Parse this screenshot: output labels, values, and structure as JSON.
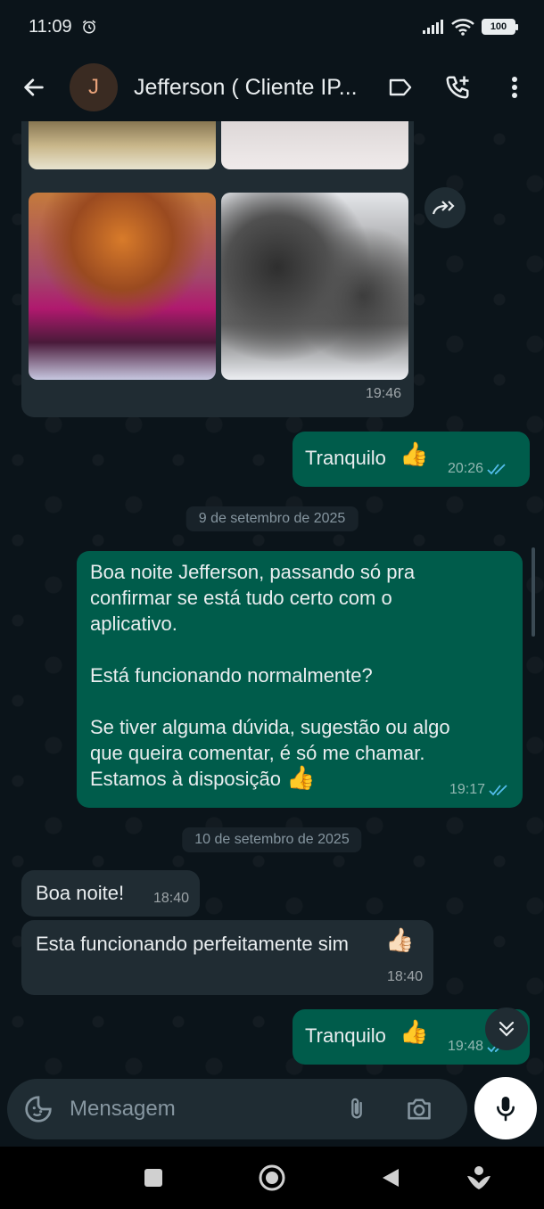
{
  "status_bar": {
    "time": "11:09",
    "battery": "100",
    "icons": [
      "alarm-icon",
      "signal-icon",
      "wifi-icon",
      "battery-icon"
    ]
  },
  "header": {
    "avatar_initial": "J",
    "contact_name": "Jefferson ( Cliente IP...",
    "icons": [
      "back-arrow-icon",
      "label-icon",
      "add-call-icon",
      "more-vert-icon"
    ]
  },
  "colors": {
    "background": "#0b141a",
    "incoming_bubble": "#202c33",
    "outgoing_bubble": "#005c4b",
    "read_ticks": "#53bdeb"
  },
  "messages": [
    {
      "id": "album",
      "direction": "in",
      "type": "photo-album",
      "time": "19:46"
    },
    {
      "id": "m1",
      "direction": "out",
      "text": "Tranquilo",
      "emoji": "👍",
      "time": "20:26",
      "read": true
    },
    {
      "id": "d1",
      "type": "date",
      "text": "9 de setembro de 2025"
    },
    {
      "id": "m2",
      "direction": "out",
      "lines": [
        "Boa noite Jefferson, passando só pra",
        "confirmar se está tudo certo com o",
        "aplicativo.",
        "",
        "Está funcionando normalmente?",
        "",
        "Se tiver alguma dúvida, sugestão ou algo",
        "que queira comentar, é só me chamar.",
        "Estamos à disposição"
      ],
      "emoji": "👍",
      "time": "19:17",
      "read": true
    },
    {
      "id": "d2",
      "type": "date",
      "text": "10 de setembro de 2025"
    },
    {
      "id": "m3",
      "direction": "in",
      "text": "Boa noite!",
      "time": "18:40"
    },
    {
      "id": "m4",
      "direction": "in",
      "text": "Esta funcionando perfeitamente sim",
      "emoji": "👍🏻",
      "time": "18:40"
    },
    {
      "id": "m5",
      "direction": "out",
      "text": "Tranquilo",
      "emoji": "👍",
      "time": "19:48",
      "read": true
    }
  ],
  "composer": {
    "placeholder": "Mensagem",
    "icons": [
      "sticker-icon",
      "attach-icon",
      "camera-icon",
      "mic-icon"
    ]
  },
  "nav": {
    "icons": [
      "recents-square-icon",
      "home-circle-icon",
      "back-triangle-icon",
      "assistant-icon"
    ]
  }
}
